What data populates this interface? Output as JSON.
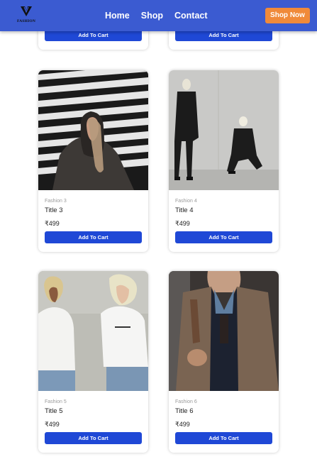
{
  "header": {
    "logo_text": "FASHION",
    "nav": [
      "Home",
      "Shop",
      "Contact"
    ],
    "cta": "Shop Now"
  },
  "colors": {
    "header": "#3b5bd1",
    "cta": "#f08a3a",
    "button": "#1f48d6"
  },
  "cards_top": [
    {
      "button": "Add To Cart"
    },
    {
      "button": "Add To Cart"
    }
  ],
  "products": [
    {
      "brand": "Fashion 3",
      "title": "Title 3",
      "price": "₹499",
      "button": "Add To Cart",
      "image": "hooded-model-photo"
    },
    {
      "brand": "Fashion 4",
      "title": "Title 4",
      "price": "₹499",
      "button": "Add To Cart",
      "image": "two-models-concrete-wall-photo"
    },
    {
      "brand": "Fashion 5",
      "title": "Title 5",
      "price": "₹499",
      "button": "Add To Cart",
      "image": "couple-white-tees-photo"
    },
    {
      "brand": "Fashion 6",
      "title": "Title 6",
      "price": "₹499",
      "button": "Add To Cart",
      "image": "man-tweed-jacket-photo"
    }
  ]
}
